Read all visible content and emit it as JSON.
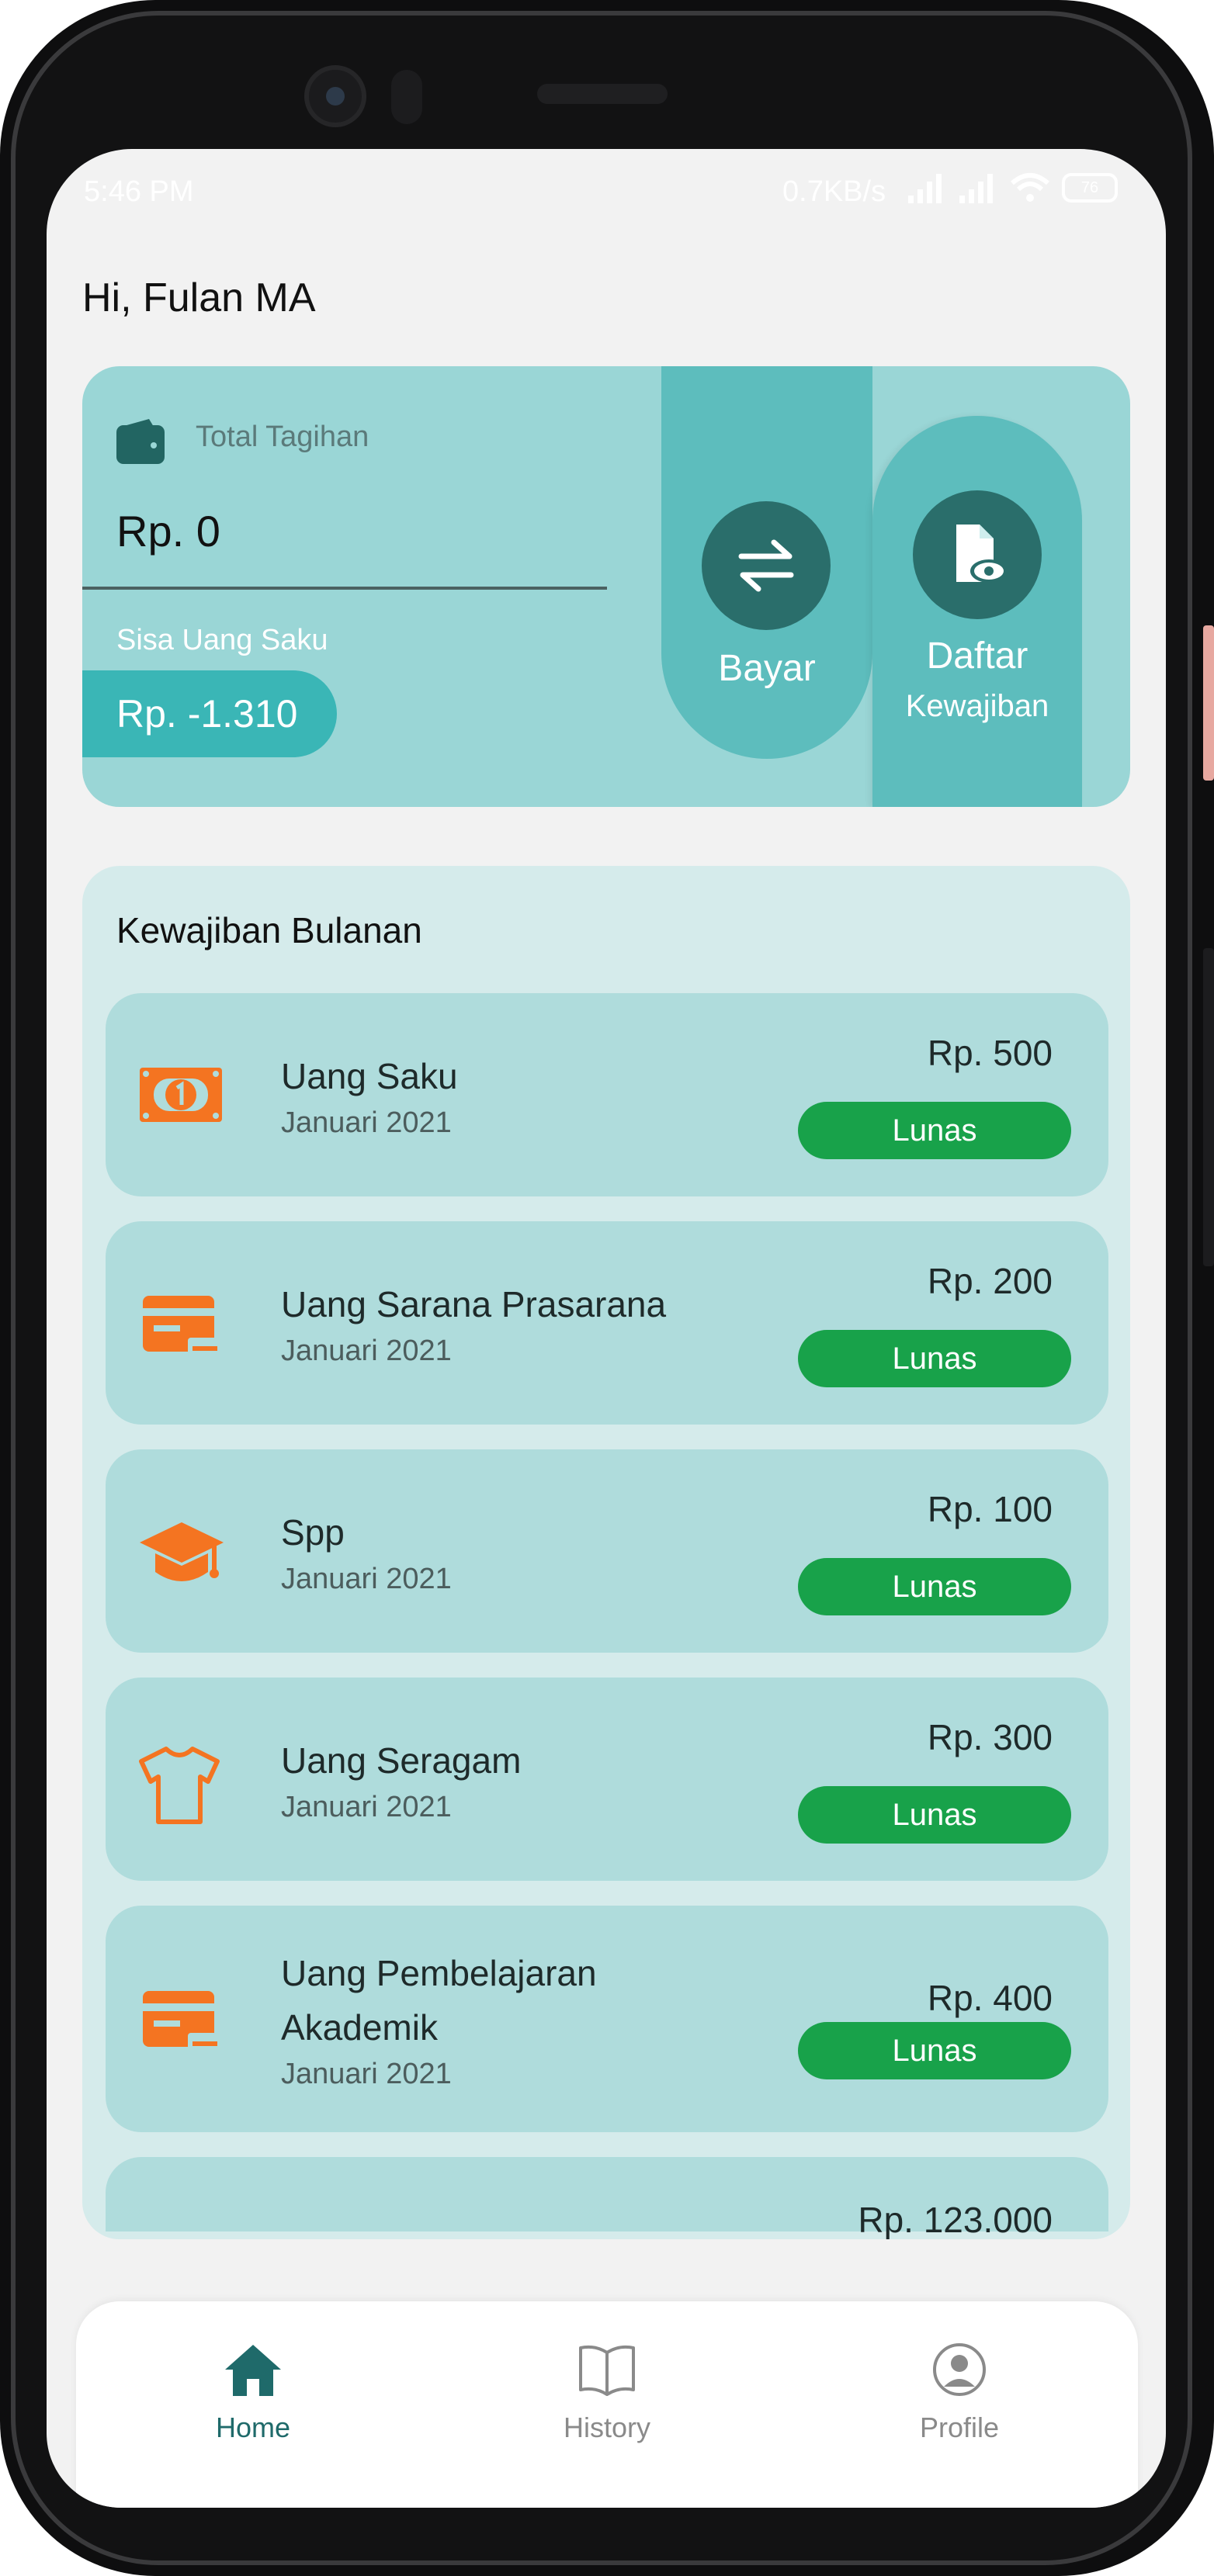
{
  "status_bar": {
    "time": "5:46 PM",
    "network_speed": "0.7KB/s",
    "battery_level": "76"
  },
  "greeting": "Hi, Fulan MA",
  "summary": {
    "total_label": "Total Tagihan",
    "total_value": "Rp.  0",
    "remaining_label": "Sisa Uang Saku",
    "remaining_value": "Rp.  -1.310",
    "pay_label": "Bayar",
    "list_label": "Daftar",
    "list_sublabel": "Kewajiban"
  },
  "monthly": {
    "title": "Kewajiban Bulanan",
    "items": [
      {
        "name": "Uang Saku",
        "date": "Januari 2021",
        "amount": "Rp.  500",
        "status": "Lunas",
        "icon": "cash-icon"
      },
      {
        "name": "Uang Sarana Prasarana",
        "date": "Januari 2021",
        "amount": "Rp.  200",
        "status": "Lunas",
        "icon": "card-icon"
      },
      {
        "name": "Spp",
        "date": "Januari 2021",
        "amount": "Rp.  100",
        "status": "Lunas",
        "icon": "graduation-cap-icon"
      },
      {
        "name": "Uang Seragam",
        "date": "Januari 2021",
        "amount": "Rp.  300",
        "status": "Lunas",
        "icon": "shirt-icon"
      },
      {
        "name": "Uang Pembelajaran Akademik",
        "date": "Januari 2021",
        "amount": "Rp.  400",
        "status": "Lunas",
        "icon": "card-icon"
      },
      {
        "amount": "Rp. 123.000"
      }
    ]
  },
  "nav": {
    "items": [
      {
        "label": "Home",
        "icon": "home-icon",
        "active": true
      },
      {
        "label": "History",
        "icon": "book-icon",
        "active": false
      },
      {
        "label": "Profile",
        "icon": "user-circle-icon",
        "active": false
      }
    ]
  },
  "colors": {
    "accent": "#2a6e6b",
    "card": "#9ad6d6",
    "item": "#afdcdc",
    "paid": "#18a24a",
    "icon": "#f47421"
  }
}
